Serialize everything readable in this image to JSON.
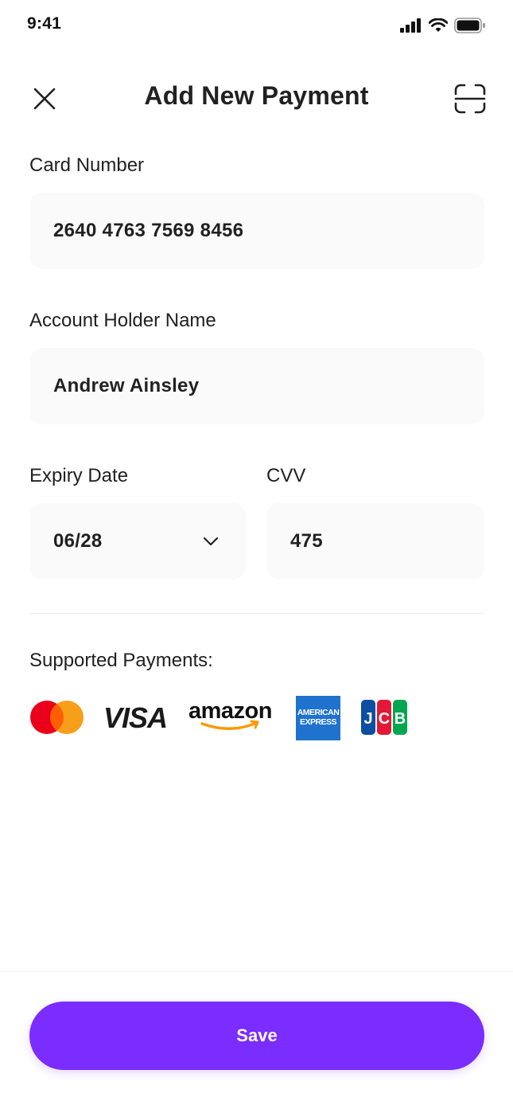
{
  "status_bar": {
    "time": "9:41"
  },
  "header": {
    "title": "Add New Payment",
    "close_icon": "close-icon",
    "scan_icon": "scan-icon"
  },
  "form": {
    "card_number": {
      "label": "Card Number",
      "value": "2640 4763 7569 8456"
    },
    "holder_name": {
      "label": "Account Holder Name",
      "value": "Andrew Ainsley"
    },
    "expiry": {
      "label": "Expiry Date",
      "value": "06/28"
    },
    "cvv": {
      "label": "CVV",
      "value": "475"
    }
  },
  "supported": {
    "label": "Supported Payments:",
    "methods": [
      "Mastercard",
      "VISA",
      "amazon",
      "American Express",
      "JCB"
    ]
  },
  "save_label": "Save",
  "colors": {
    "accent": "#7b2cff",
    "field_bg": "#fafafa",
    "text": "#212121"
  }
}
